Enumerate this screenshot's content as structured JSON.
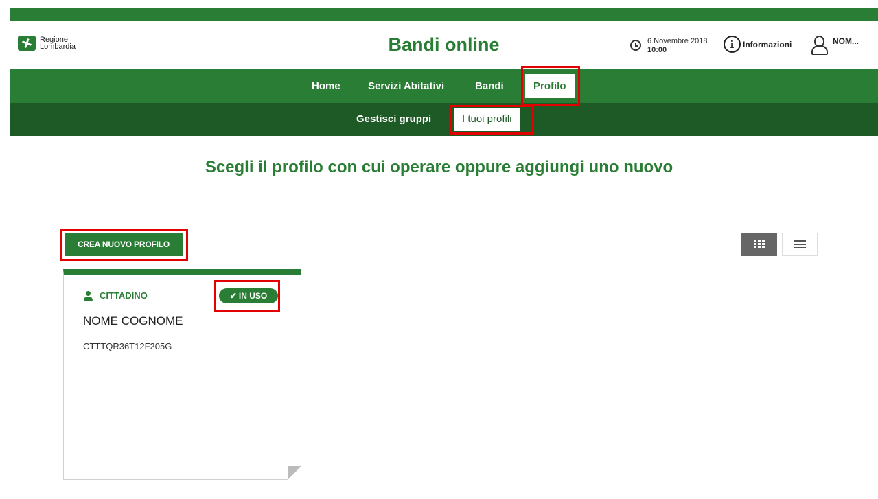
{
  "header": {
    "logo_line1": "Regione",
    "logo_line2": "Lombardia",
    "title": "Bandi online",
    "date": "6 Novembre 2018",
    "time": "10:00",
    "info_label": "Informazioni",
    "user_name": "NOM..."
  },
  "nav": {
    "items": [
      {
        "label": "Home"
      },
      {
        "label": "Servizi Abitativi"
      },
      {
        "label": "Bandi"
      },
      {
        "label": "Profilo"
      }
    ],
    "active": "Profilo"
  },
  "subnav": {
    "items": [
      {
        "label": "Gestisci gruppi"
      },
      {
        "label": "I tuoi profili"
      }
    ],
    "active": "I tuoi profili"
  },
  "main": {
    "heading": "Scegli il profilo con cui operare oppure aggiungi uno nuovo",
    "create_button": "CREA NUOVO PROFILO",
    "view_modes": [
      "grid-icon",
      "list-icon"
    ],
    "selected_view": "grid"
  },
  "profile_card": {
    "type": "CITTADINO",
    "status": "IN USO",
    "name": "NOME COGNOME",
    "code": "CTTTQR36T12F205G"
  },
  "colors": {
    "brand_green": "#2a7d34",
    "dark_green": "#1d5a26",
    "highlight_red": "#e30000"
  }
}
